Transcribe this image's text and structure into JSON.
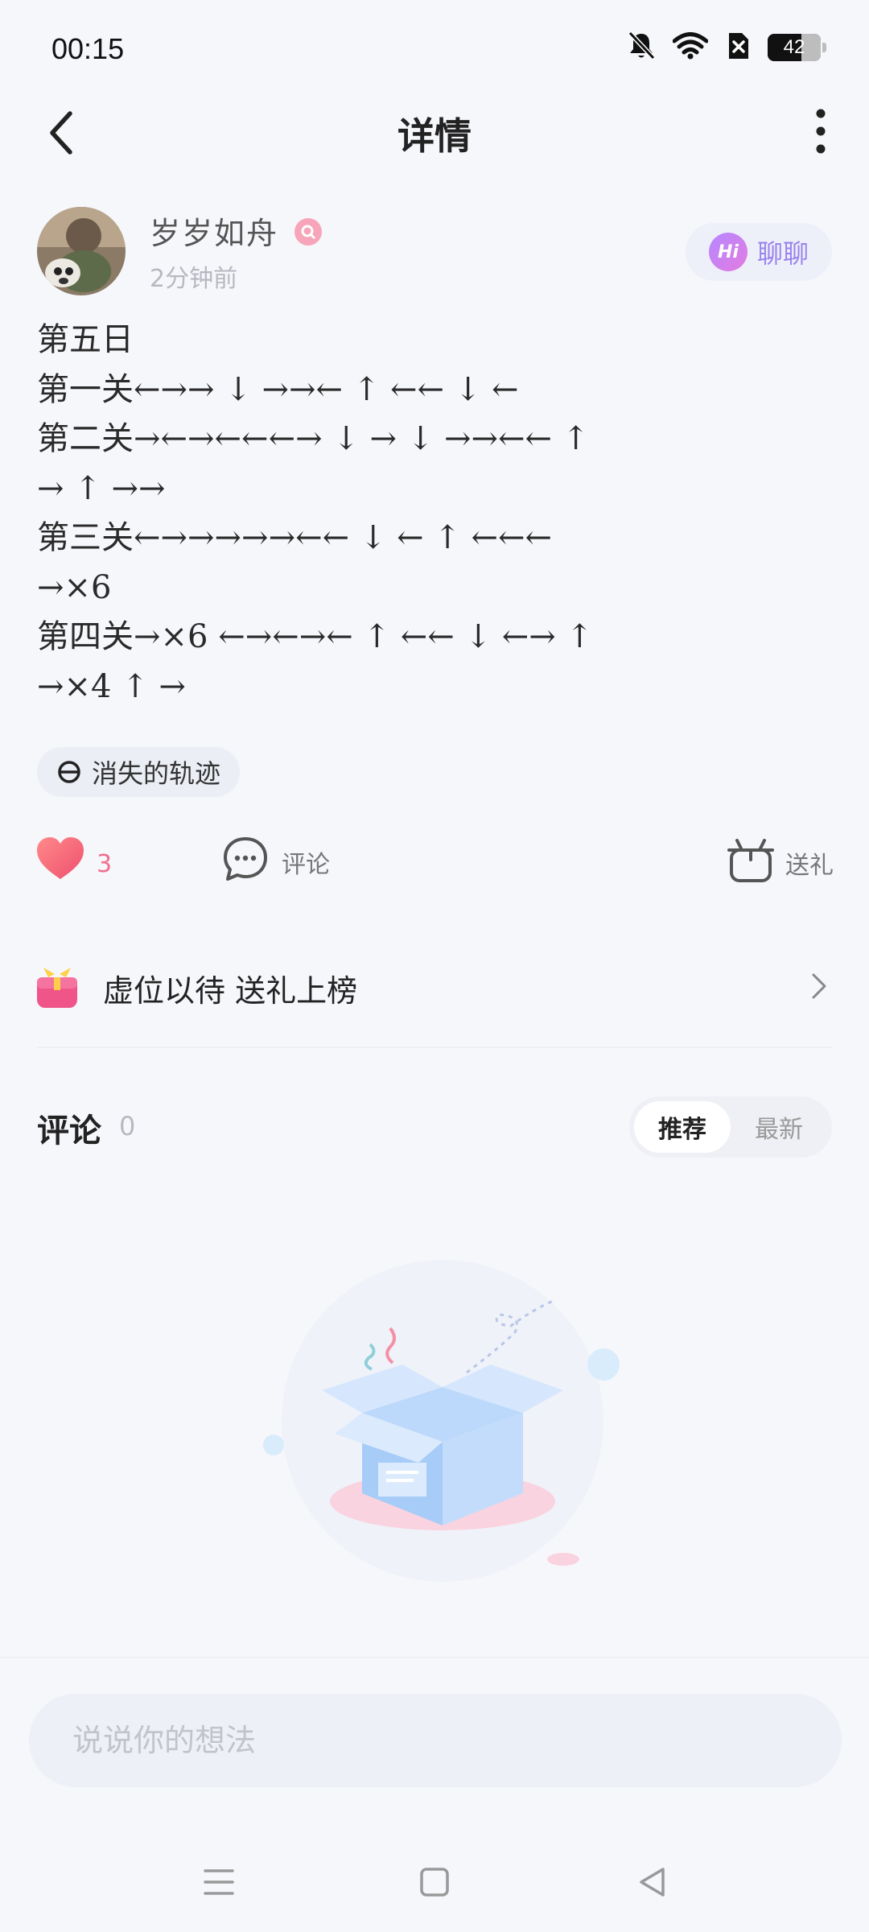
{
  "status_bar": {
    "time": "00:15",
    "battery": "42"
  },
  "header": {
    "title": "详情"
  },
  "author": {
    "name": "岁岁如舟",
    "time_ago": "2分钟前",
    "chat_badge": "Hi",
    "chat_label": "聊聊"
  },
  "post": {
    "lines": [
      "第五日",
      "第一关←→→ ↓ →→← ↑ ←← ↓ ←",
      "第二关→←→←←←→ ↓ → ↓ →→←← ↑",
      "→ ↑ →→",
      "第三关←→→→→→←← ↓ ← ↑ ←←←",
      "→×6",
      "第四关→×6 ←→←→← ↑ ←← ↓ ←→ ↑",
      "→×4 ↑ →"
    ]
  },
  "topic": {
    "label": "消失的轨迹"
  },
  "actions": {
    "like_count": "3",
    "comment_label": "评论",
    "gift_label": "送礼"
  },
  "gift_rank": {
    "label": "虚位以待 送礼上榜"
  },
  "comments": {
    "title": "评论",
    "count": "0",
    "sort_options": [
      "推荐",
      "最新"
    ],
    "active_sort": "推荐"
  },
  "comment_input": {
    "placeholder": "说说你的想法"
  },
  "colors": {
    "accent_purple": "#9a82ee",
    "like_red": "#f2607d",
    "background": "#f6f7fb"
  }
}
